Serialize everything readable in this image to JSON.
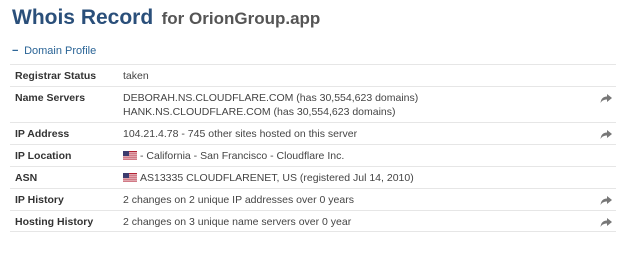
{
  "header": {
    "title": "Whois Record",
    "subtitle": "for OrionGroup.app"
  },
  "section": {
    "toggle_symbol": "−",
    "label": "Domain Profile"
  },
  "rows": [
    {
      "label": "Registrar Status",
      "lines": [
        "taken"
      ],
      "has_action": false
    },
    {
      "label": "Name Servers",
      "lines": [
        "DEBORAH.NS.CLOUDFLARE.COM (has 30,554,623 domains)",
        "HANK.NS.CLOUDFLARE.COM (has 30,554,623 domains)"
      ],
      "has_action": true,
      "action_icon": "share-arrow-icon"
    },
    {
      "label": "IP Address",
      "lines": [
        "104.21.4.78 - 745 other sites hosted on this server"
      ],
      "has_action": true,
      "action_icon": "share-arrow-icon"
    },
    {
      "label": "IP Location",
      "lines": [
        "- California - San Francisco - Cloudflare Inc."
      ],
      "flag": "us-flag-icon",
      "has_action": false
    },
    {
      "label": "ASN",
      "lines": [
        "AS13335 CLOUDFLARENET, US (registered Jul 14, 2010)"
      ],
      "flag": "us-flag-icon",
      "has_action": false
    },
    {
      "label": "IP History",
      "lines": [
        "2 changes on 2 unique IP addresses over 0 years"
      ],
      "has_action": true,
      "action_icon": "share-arrow-icon"
    },
    {
      "label": "Hosting History",
      "lines": [
        "2 changes on 3 unique name servers over 0 year"
      ],
      "has_action": true,
      "action_icon": "share-arrow-icon"
    }
  ],
  "colors": {
    "title": "#2a4f7a",
    "link": "#2a6496",
    "divider": "#e6e6e6",
    "action_icon": "#777777"
  }
}
